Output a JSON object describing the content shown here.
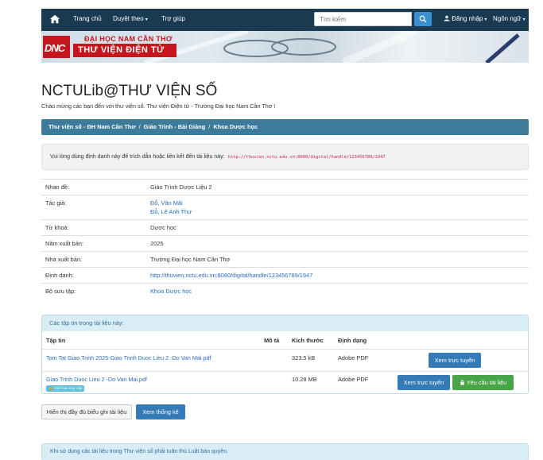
{
  "nav": {
    "home": "Trang chủ",
    "browse": "Duyệt theo",
    "help": "Trợ giúp",
    "search_placeholder": "Tìm kiếm",
    "login": "Đăng nhập",
    "language": "Ngôn ngữ"
  },
  "banner": {
    "logo": "DNC",
    "line1": "ĐẠI HỌC NAM CẦN THƠ",
    "line2": "THƯ VIỆN ĐIỆN TỬ"
  },
  "page": {
    "title": "NCTULib@THƯ VIỆN SỐ",
    "intro": "Chào mừng các bạn đến với thư viện số. Thư viện Điện tử - Trường Đại học Nam Cần Thơ !"
  },
  "breadcrumb": [
    "Thư viện số - ĐH Nam Cần Thơ",
    "Giáo Trình - Bài Giảng",
    "Khoa Dược học"
  ],
  "cite": {
    "text": "Vui lòng dùng định danh này để trích dẫn hoặc liên kết đến tài liệu này:",
    "url": "http://thuvien.nctu.edu.vn:8080/digital/handle/123456789/1947"
  },
  "meta": [
    {
      "label": "Nhan đề:",
      "value": "Giáo Trình Dược Liệu 2"
    },
    {
      "label": "Tác giả:",
      "value": "Đỗ, Văn Mãi",
      "value2": "Đỗ, Lê Anh Thư"
    },
    {
      "label": "Từ khoá:",
      "value": "Dược học"
    },
    {
      "label": "Năm xuất bản:",
      "value": "2025"
    },
    {
      "label": "Nhà xuất bản:",
      "value": "Trường Đại học Nam Cần Thơ"
    },
    {
      "label": "Định danh:",
      "value": "http://thuvien.nctu.edu.vn:8080/digital/handle/123456789/1947"
    },
    {
      "label": "Bộ sưu tập:",
      "value": "Khoa Dược học"
    }
  ],
  "files": {
    "heading": "Các tập tin trong tài liệu này:",
    "columns": [
      "Tập tin",
      "Mô tả",
      "Kích thước",
      "Định dạng"
    ],
    "rows": [
      {
        "name": "Tom Tat Giao Trinh 2025-Giao Trinh Duoc Lieu 2 -Do Van Mai.pdf",
        "size": "323.5 kB",
        "format": "Adobe PDF",
        "view": "Xem trực tuyến"
      },
      {
        "name": "Giao Trinh Duoc Lieu 2 -Do Van Mai.pdf",
        "tag": "Giới hạn truy cập",
        "size": "10.28 MB",
        "format": "Adobe PDF",
        "view": "Xem trực tuyến",
        "request": "Yêu cầu tài liệu"
      }
    ]
  },
  "actions": {
    "full_record": "Hiển thị đầy đủ biểu ghi tài liệu",
    "stats": "Xem thống kê"
  },
  "footer_note": "Khi sử dụng các tài liệu trong Thư viện số phải tuân thủ Luật bản quyền.",
  "colors": {
    "navbar": "#1a3a52",
    "brand_red": "#c5161d",
    "crumb": "#3d7b9a",
    "primary": "#337ab7",
    "success": "#47a447"
  }
}
